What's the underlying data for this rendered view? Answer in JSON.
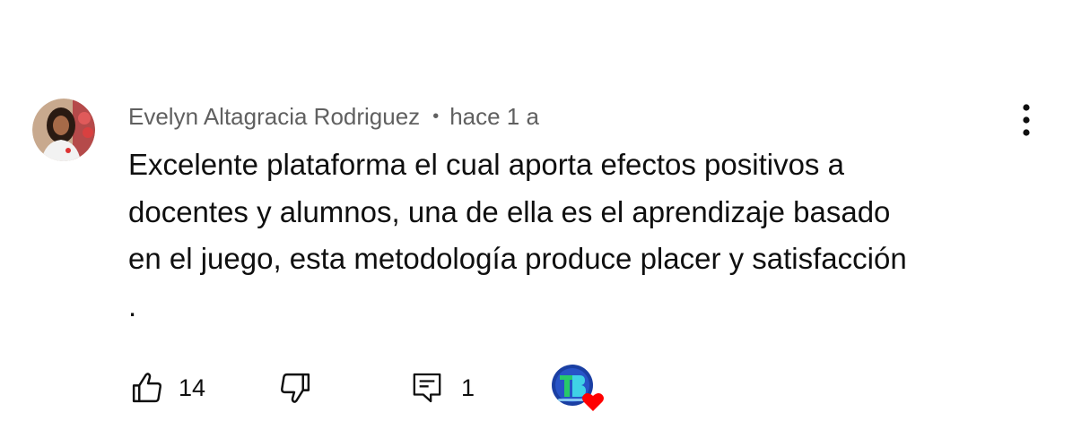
{
  "comment": {
    "author": "Evelyn Altagracia Rodriguez",
    "separator": "•",
    "time": "hace 1 a",
    "text_lines": [
      "Excelente plataforma el cual aporta efectos positivos a",
      "docentes y alumnos, una de ella es el aprendizaje basado",
      "en el juego, esta metodología produce placer y satisfacción",
      "."
    ],
    "likes": "14",
    "replies": "1",
    "creator_heart_badge": {
      "icon": "creator-avatar-with-heart",
      "accent": "#ff0000"
    },
    "more_menu_icon": "three-dots-vertical-icon"
  },
  "colors": {
    "text_primary": "#0f0f0f",
    "text_secondary": "#606060",
    "heart": "#ff0000"
  }
}
